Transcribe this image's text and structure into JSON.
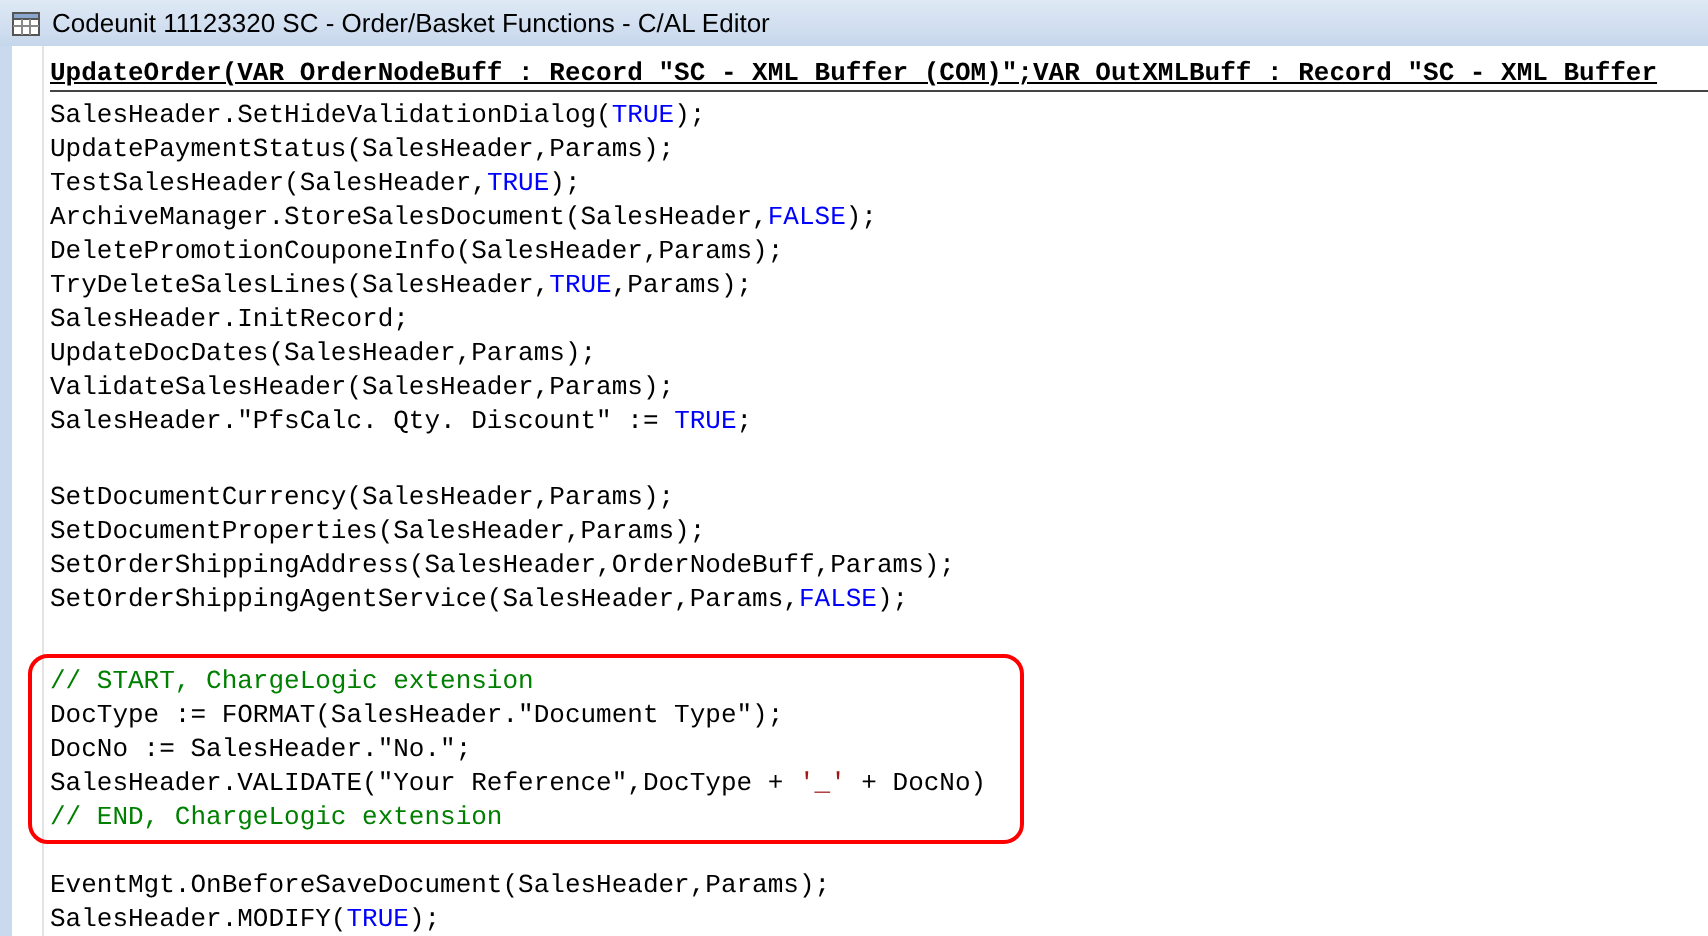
{
  "window": {
    "title": "Codeunit 11123320 SC - Order/Basket Functions - C/AL Editor"
  },
  "function_header": "UpdateOrder(VAR OrderNodeBuff : Record \"SC - XML Buffer (COM)\";VAR OutXMLBuff : Record \"SC - XML Buffer",
  "blocks": [
    {
      "highlighted": false,
      "lines": [
        [
          {
            "kind": "code",
            "text": "SalesHeader.SetHideValidationDialog("
          },
          {
            "kind": "keyword",
            "text": "TRUE"
          },
          {
            "kind": "code",
            "text": ");"
          }
        ],
        [
          {
            "kind": "code",
            "text": "UpdatePaymentStatus(SalesHeader,Params);"
          }
        ],
        [
          {
            "kind": "code",
            "text": "TestSalesHeader(SalesHeader,"
          },
          {
            "kind": "keyword",
            "text": "TRUE"
          },
          {
            "kind": "code",
            "text": ");"
          }
        ],
        [
          {
            "kind": "code",
            "text": "ArchiveManager.StoreSalesDocument(SalesHeader,"
          },
          {
            "kind": "keyword",
            "text": "FALSE"
          },
          {
            "kind": "code",
            "text": ");"
          }
        ],
        [
          {
            "kind": "code",
            "text": "DeletePromotionCouponeInfo(SalesHeader,Params);"
          }
        ],
        [
          {
            "kind": "code",
            "text": "TryDeleteSalesLines(SalesHeader,"
          },
          {
            "kind": "keyword",
            "text": "TRUE"
          },
          {
            "kind": "code",
            "text": ",Params);"
          }
        ],
        [
          {
            "kind": "code",
            "text": "SalesHeader.InitRecord;"
          }
        ],
        [
          {
            "kind": "code",
            "text": "UpdateDocDates(SalesHeader,Params);"
          }
        ],
        [
          {
            "kind": "code",
            "text": "ValidateSalesHeader(SalesHeader,Params);"
          }
        ],
        [
          {
            "kind": "code",
            "text": "SalesHeader.\"PfsCalc. Qty. Discount\" := "
          },
          {
            "kind": "keyword",
            "text": "TRUE"
          },
          {
            "kind": "code",
            "text": ";"
          }
        ]
      ]
    },
    {
      "highlighted": false,
      "lines": [
        [
          {
            "kind": "code",
            "text": "SetDocumentCurrency(SalesHeader,Params);"
          }
        ],
        [
          {
            "kind": "code",
            "text": "SetDocumentProperties(SalesHeader,Params);"
          }
        ],
        [
          {
            "kind": "code",
            "text": "SetOrderShippingAddress(SalesHeader,OrderNodeBuff,Params);"
          }
        ],
        [
          {
            "kind": "code",
            "text": "SetOrderShippingAgentService(SalesHeader,Params,"
          },
          {
            "kind": "keyword",
            "text": "FALSE"
          },
          {
            "kind": "code",
            "text": ");"
          }
        ]
      ]
    },
    {
      "highlighted": true,
      "lines": [
        [
          {
            "kind": "comment",
            "text": "// START, ChargeLogic extension"
          }
        ],
        [
          {
            "kind": "code",
            "text": "DocType := FORMAT(SalesHeader.\"Document Type\");"
          }
        ],
        [
          {
            "kind": "code",
            "text": "DocNo := SalesHeader.\"No.\";"
          }
        ],
        [
          {
            "kind": "code",
            "text": "SalesHeader.VALIDATE(\"Your Reference\",DocType + "
          },
          {
            "kind": "string",
            "text": "'_'"
          },
          {
            "kind": "code",
            "text": " + DocNo)"
          }
        ],
        [
          {
            "kind": "comment",
            "text": "// END, ChargeLogic extension"
          }
        ]
      ]
    },
    {
      "highlighted": false,
      "lines": [
        [
          {
            "kind": "code",
            "text": "EventMgt.OnBeforeSaveDocument(SalesHeader,Params);"
          }
        ],
        [
          {
            "kind": "code",
            "text": "SalesHeader.MODIFY("
          },
          {
            "kind": "keyword",
            "text": "TRUE"
          },
          {
            "kind": "code",
            "text": ");"
          }
        ]
      ]
    }
  ]
}
